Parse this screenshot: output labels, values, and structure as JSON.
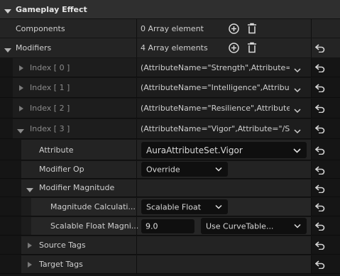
{
  "header": {
    "title": "Gameplay Effect"
  },
  "components": {
    "label": "Components",
    "value": "0 Array element"
  },
  "modifiers": {
    "label": "Modifiers",
    "value": "4 Array elements"
  },
  "indices": [
    {
      "label": "Index [ 0 ]",
      "value": "(AttributeName=\"Strength\",Attribute=\"/S"
    },
    {
      "label": "Index [ 1 ]",
      "value": "(AttributeName=\"Intelligence\",Attribute="
    },
    {
      "label": "Index [ 2 ]",
      "value": "(AttributeName=\"Resilience\",Attribute=\""
    },
    {
      "label": "Index [ 3 ]",
      "value": "(AttributeName=\"Vigor\",Attribute=\"/Scri"
    }
  ],
  "attribute": {
    "label": "Attribute",
    "value": "AuraAttributeSet.Vigor"
  },
  "modifier_op": {
    "label": "Modifier Op",
    "value": "Override"
  },
  "modifier_magnitude": {
    "label": "Modifier Magnitude"
  },
  "magnitude_calc": {
    "label": "Magnitude Calculati...",
    "value": "Scalable Float"
  },
  "scalable_float": {
    "label": "Scalable Float Magni...",
    "value": "9.0",
    "curve": "Use CurveTable..."
  },
  "source_tags": {
    "label": "Source Tags"
  },
  "target_tags": {
    "label": "Target Tags"
  },
  "colors": {
    "accent_reset": "#d4d4d4",
    "row_bg": "#232323",
    "header_bg": "#2f2f2f"
  }
}
